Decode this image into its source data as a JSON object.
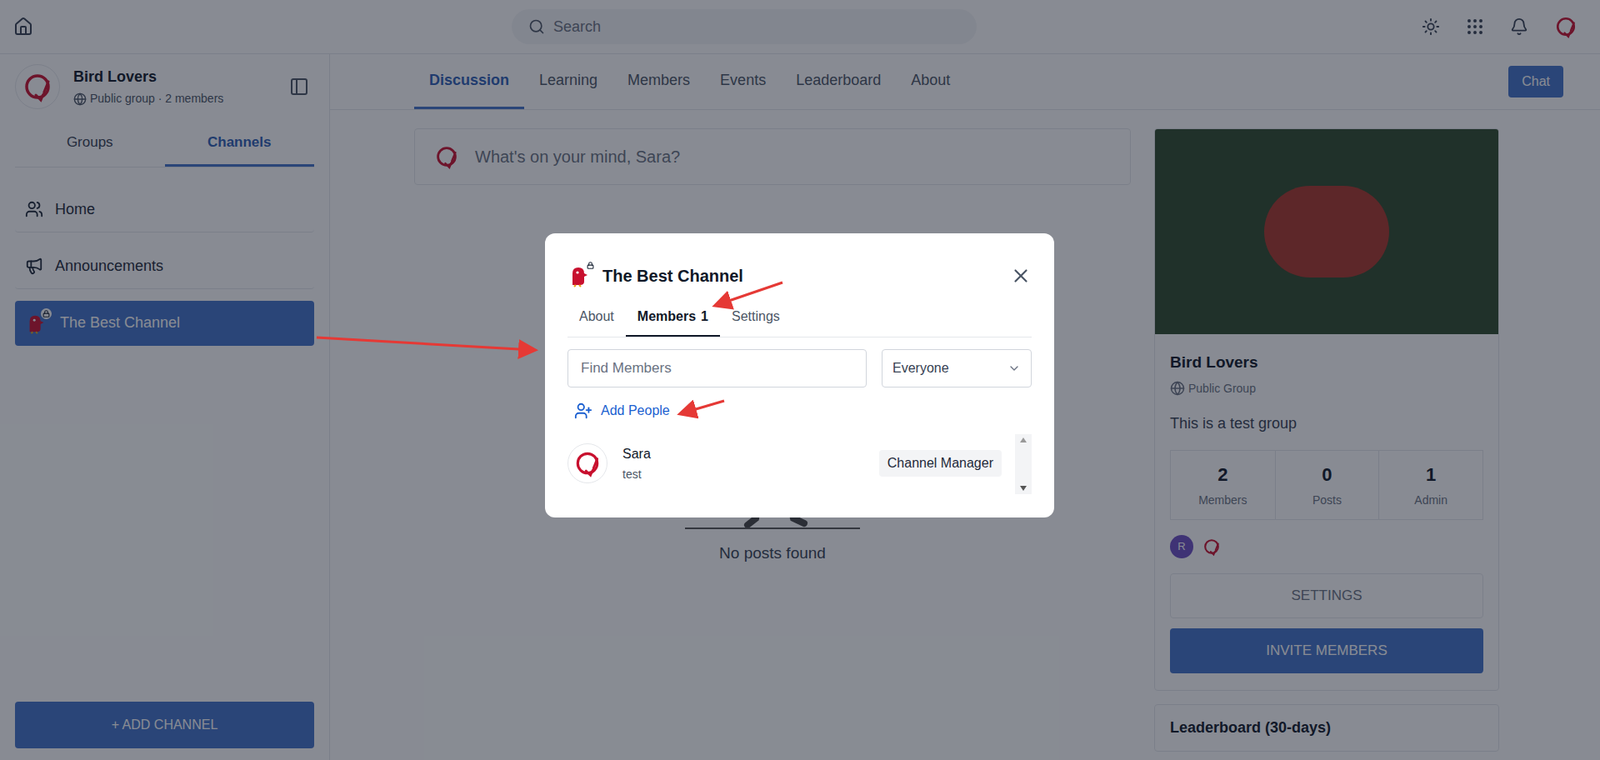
{
  "topbar": {
    "search_placeholder": "Search"
  },
  "group": {
    "name": "Bird Lovers",
    "meta": "Public group · 2 members"
  },
  "sidebar_tabs": [
    {
      "label": "Groups",
      "selected": false
    },
    {
      "label": "Channels",
      "selected": true
    }
  ],
  "sidebar_items": [
    {
      "label": "Home",
      "kind": "home",
      "selected": false
    },
    {
      "label": "Announcements",
      "kind": "announcements",
      "selected": false
    },
    {
      "label": "The Best Channel",
      "kind": "channel",
      "selected": true
    }
  ],
  "add_channel": "+ ADD CHANNEL",
  "main_tabs": [
    {
      "label": "Discussion",
      "selected": true
    },
    {
      "label": "Learning",
      "selected": false
    },
    {
      "label": "Members",
      "selected": false
    },
    {
      "label": "Events",
      "selected": false
    },
    {
      "label": "Leaderboard",
      "selected": false
    },
    {
      "label": "About",
      "selected": false
    }
  ],
  "chat_button": "Chat",
  "composer_placeholder": "What's on your mind, Sara?",
  "empty_state": "No posts found",
  "group_card": {
    "name": "Bird Lovers",
    "privacy": "Public Group",
    "description": "This is a test group",
    "stats": [
      {
        "value": "2",
        "label": "Members"
      },
      {
        "value": "0",
        "label": "Posts"
      },
      {
        "value": "1",
        "label": "Admin"
      }
    ],
    "member_avatars": [
      {
        "kind": "initial",
        "initial": "R",
        "color": "#6d4fc2"
      },
      {
        "kind": "logo",
        "initial": "",
        "color": "#ffffff"
      }
    ],
    "settings_button": "SETTINGS",
    "invite_button": "INVITE MEMBERS",
    "leaderboard_title": "Leaderboard (30-days)"
  },
  "modal": {
    "title": "The Best Channel",
    "locked": true,
    "tabs": [
      {
        "label": "About",
        "count": "",
        "selected": false
      },
      {
        "label": "Members",
        "count": "1",
        "selected": true
      },
      {
        "label": "Settings",
        "count": "",
        "selected": false
      }
    ],
    "search_placeholder": "Find Members",
    "filter": "Everyone",
    "add_people": "Add People",
    "members": [
      {
        "name": "Sara",
        "subtitle": "test",
        "role": "Channel Manager"
      }
    ]
  }
}
